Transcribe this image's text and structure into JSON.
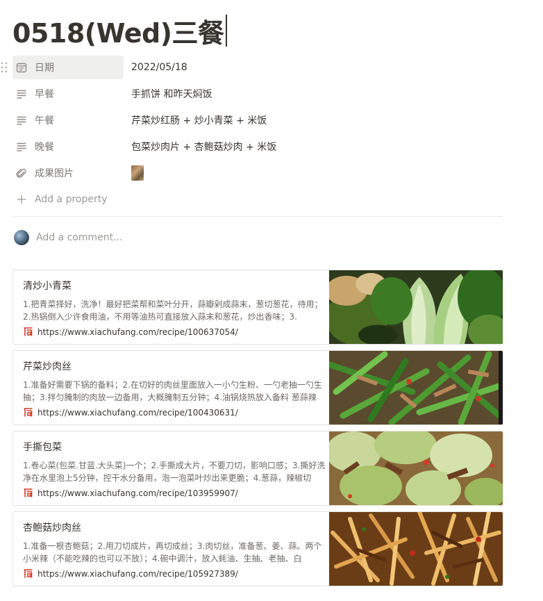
{
  "page": {
    "title": "0518(Wed)三餐"
  },
  "properties": [
    {
      "icon": "calendar-icon",
      "label": "日期",
      "value": "2022/05/18"
    },
    {
      "icon": "text-lines-icon",
      "label": "早餐",
      "value": "手抓饼 和昨天焖饭"
    },
    {
      "icon": "text-lines-icon",
      "label": "午餐",
      "value": "芹菜炒红肠 + 炒小青菜 + 米饭"
    },
    {
      "icon": "text-lines-icon",
      "label": "晚餐",
      "value": "包菜炒肉片 + 杏鲍菇炒肉 + 米饭"
    },
    {
      "icon": "paperclip-icon",
      "label": "成果图片",
      "value": ""
    }
  ],
  "add_property_label": "Add a property",
  "comment_placeholder": "Add a comment...",
  "bookmarks": [
    {
      "title": "清炒小青菜",
      "description": "1.把青菜择好，洗净！最好把菜帮和菜叶分开，蒜瓣剁成蒜末，葱切葱花，待用；2.热锅倒入少许食用油，不用等油热可直接放入蒜末和葱花，炒出香味；3.",
      "url": "https://www.xiachufang.com/recipe/100637054/",
      "image": "bok-choy-photo"
    },
    {
      "title": "芹菜炒肉丝",
      "description": "1.准备好需要下锅的备料；2.在切好的肉丝里面放入一小勺生粉、一勺老抽一勺生抽；3.拌匀腌制的肉放一边备用，大概腌制五分钟；4.油锅烧热放入备料 葱蒜辣",
      "url": "https://www.xiachufang.com/recipe/100430631/",
      "image": "celery-pork-photo"
    },
    {
      "title": "手撕包菜",
      "description": "1.卷心菜(包菜.甘蓝.大头菜)一个；2.手撕成大片，不要刀切，影响口感；3.撕好洗净在水里泡上5分钟，控干水分备用，泡一泡菜叶炒出来更脆；4.葱蒜，辣椒切",
      "url": "https://www.xiachufang.com/recipe/103959907/",
      "image": "cabbage-photo"
    },
    {
      "title": "杏鲍菇炒肉丝",
      "description": "1.准备一根杏鲍菇；2.用刀切成片，再切成丝；3.肉切丝，准备葱、姜、蒜。两个小米辣（不能吃辣的也可以不放）；4.碗中调汁，放入蚝油、生抽、老抽、白",
      "url": "https://www.xiachufang.com/recipe/105927389/",
      "image": "mushroom-pork-photo"
    }
  ],
  "colors": {
    "text": "#37352f",
    "muted": "#7a7875",
    "placeholder": "#9b9a97",
    "favicon": "#d9372a",
    "border": "#e3e2df"
  }
}
